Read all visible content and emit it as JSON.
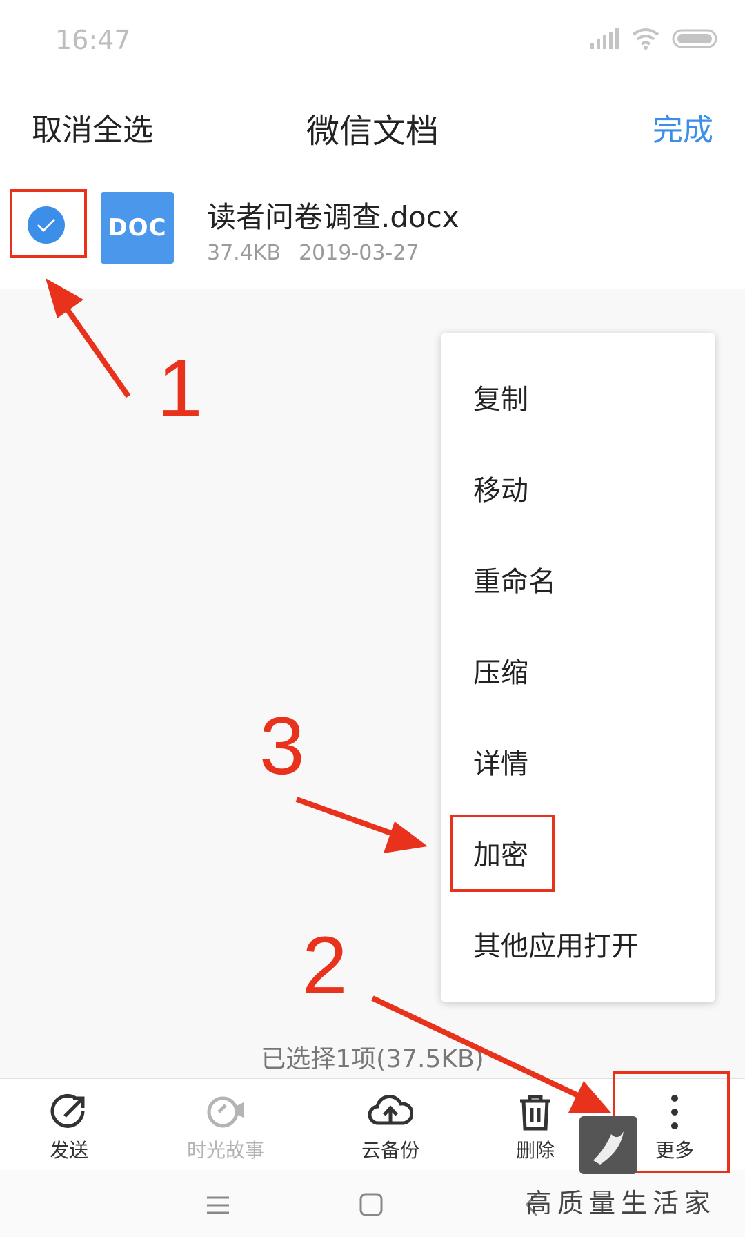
{
  "status_bar": {
    "time": "16:47"
  },
  "header": {
    "left_label": "取消全选",
    "title": "微信文档",
    "right_label": "完成"
  },
  "file": {
    "icon_text": "DOC",
    "name": "读者问卷调查.docx",
    "size": "37.4KB",
    "date": "2019-03-27",
    "checked": true
  },
  "menu": {
    "items": [
      "复制",
      "移动",
      "重命名",
      "压缩",
      "详情",
      "加密",
      "其他应用打开"
    ]
  },
  "selection_info": "已选择1项(37.5KB)",
  "toolbar": {
    "send": "发送",
    "story": "时光故事",
    "backup": "云备份",
    "delete": "删除",
    "more": "更多"
  },
  "annotations": {
    "step1": "1",
    "step2": "2",
    "step3": "3"
  },
  "watermark": "高质量生活家",
  "colors": {
    "accent": "#3b8fe8",
    "doc_blue": "#4a97ec",
    "annotation_red": "#e8321c",
    "disabled": "#b4b4b4"
  }
}
